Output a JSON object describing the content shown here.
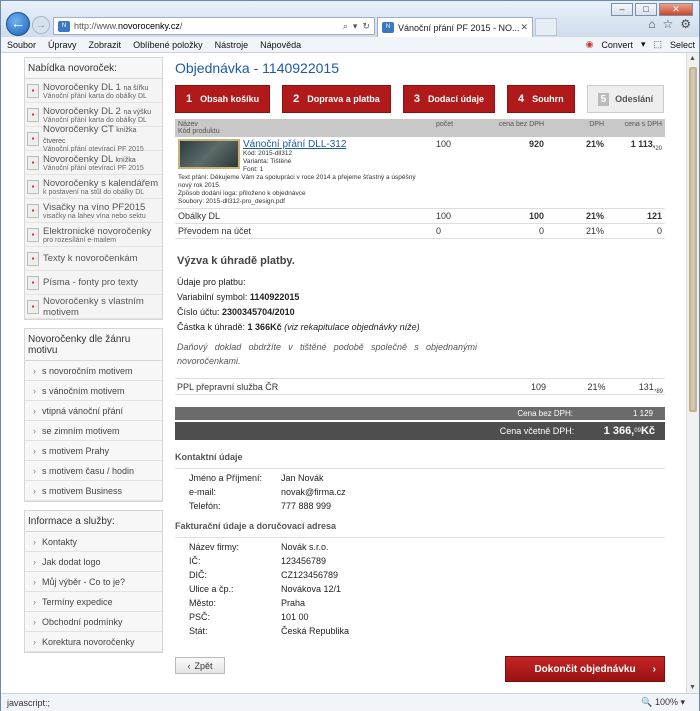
{
  "browser": {
    "url_prefix": "http://www.",
    "url_domain": "novorocenky.cz",
    "url_suffix": "/",
    "tab_title": "Vánoční přání PF 2015 - NO...",
    "min": "–",
    "max": "□",
    "close": "✕"
  },
  "menu": {
    "items": [
      "Soubor",
      "Úpravy",
      "Zobrazit",
      "Oblíbené položky",
      "Nástroje",
      "Nápověda"
    ],
    "convert": "Convert",
    "select": "Select"
  },
  "sidebar": {
    "offer_title": "Nabídka novoroček:",
    "products": [
      {
        "title": "Novoročenky DL 1",
        "suffix": "na šířku",
        "sub": "Vánoční přání karta do obálky DL"
      },
      {
        "title": "Novoročenky DL 2",
        "suffix": "na výšku",
        "sub": "Vánoční přání karta do obálky DL"
      },
      {
        "title": "Novoročenky CT",
        "suffix": "knížka čtverec",
        "sub": "Vánoční přání otevírací PF 2015"
      },
      {
        "title": "Novoročenky DL",
        "suffix": "knížka",
        "sub": "Vánoční přání otevírací PF 2015"
      },
      {
        "title": "Novoročenky s kalendářem",
        "suffix": "",
        "sub": "k postavení na stůl do obálky DL"
      },
      {
        "title": "Visačky na víno PF2015",
        "suffix": "",
        "sub": "visačky na lahev vína nebo sektu"
      },
      {
        "title": "Elektronické novoročenky",
        "suffix": "",
        "sub": "pro rozesílání e-mailem"
      },
      {
        "title": "Texty k novoročenkám",
        "suffix": "",
        "sub": ""
      },
      {
        "title": "Písma - fonty pro texty",
        "suffix": "",
        "sub": ""
      },
      {
        "title": "Novoročenky s vlastním motivem",
        "suffix": "",
        "sub": ""
      }
    ],
    "genre_title": "Novoročenky dle žánru motivu",
    "genres": [
      "s novoročním motivem",
      "s vánočním motivem",
      "vtipná vánoční přání",
      "se zimním motivem",
      "s motivem Prahy",
      "s motivem času / hodin",
      "s motivem Business"
    ],
    "info_title": "Informace a služby:",
    "info": [
      "Kontakty",
      "Jak dodat logo",
      "Můj výběr - Co to je?",
      "Termíny expedice",
      "Obchodní podmínky",
      "Korektura novoročenky"
    ]
  },
  "order": {
    "title": "Objednávka - 1140922015",
    "steps": [
      {
        "n": "1",
        "label": "Obsah košíku"
      },
      {
        "n": "2",
        "label": "Doprava a platba"
      },
      {
        "n": "3",
        "label": "Dodací údaje"
      },
      {
        "n": "4",
        "label": "Souhrn"
      },
      {
        "n": "5",
        "label": "Odeslání"
      }
    ],
    "headers": {
      "name": "Název",
      "code": "Kód produktu",
      "qty": "počet",
      "price": "cena bez DPH",
      "vat": "DPH",
      "total": "cena s DPH"
    },
    "item": {
      "name": "Vánoční přání DLL-312",
      "code": "Kód: 2015-dll312",
      "variant": "Varianta: Tištěné",
      "font": "Font: 1",
      "text": "Text přání: Děkujeme Vám za spolupráci v roce 2014 a přejeme šťastný a úspěšný nový rok 2015.",
      "logo": "Způsob dodání loga: přiloženo k objednávce",
      "files": "Soubory: 2015-dll312-pro_design.pdf",
      "qty": "100",
      "price": "920",
      "vat": "21%",
      "total": "1 113,",
      "total_cents": "20"
    },
    "rows": [
      {
        "name": "Obálky DL",
        "qty": "100",
        "price": "100",
        "vat": "21%",
        "total": "121"
      },
      {
        "name": "Převodem na účet",
        "qty": "0",
        "price": "0",
        "vat": "21%",
        "total": "0"
      }
    ],
    "payment_title": "Výzva k úhradě platby.",
    "pay_intro": "Údaje pro platbu:",
    "vs_label": "Variabilní symbol: ",
    "vs": "1140922015",
    "acct_label": "Číslo účtu: ",
    "acct": "2300345704/2010",
    "amt_label": "Částka k úhradě: ",
    "amt": "1 366Kč",
    "amt_note": " (viz rekapitulace objednávky níže)",
    "tax_note": "Daňový doklad obdržíte v tištěné podobě společně s objednanými novoročenkami.",
    "ppl": {
      "name": "PPL přepravní služba ČR",
      "price": "109",
      "vat": "21%",
      "total": "131,",
      "cents": "89"
    },
    "tot_no_vat_label": "Cena bez DPH:",
    "tot_no_vat": "1 129",
    "tot_vat_label": "Cena včetně DPH:",
    "tot_vat": "1 366,",
    "tot_vat_cents": "09",
    "tot_vat_cur": " Kč",
    "contact_title": "Kontaktní údaje",
    "contact": [
      {
        "k": "Jméno a Příjmení:",
        "v": "Jan Novák"
      },
      {
        "k": "e-mail:",
        "v": "novak@firma.cz"
      },
      {
        "k": "Telefón:",
        "v": "777 888 999"
      }
    ],
    "billing_title": "Fakturační údaje a doručovací adresa",
    "billing": [
      {
        "k": "Název firmy:",
        "v": "Novák s.r.o."
      },
      {
        "k": "IČ:",
        "v": "123456789"
      },
      {
        "k": "DIČ:",
        "v": "CZ123456789"
      },
      {
        "k": "Ulice a čp.:",
        "v": "Novákova 12/1"
      },
      {
        "k": "Město:",
        "v": "Praha"
      },
      {
        "k": "PSČ:",
        "v": "101 00"
      },
      {
        "k": "Stát:",
        "v": "Česká Republika"
      }
    ],
    "back": "Zpět",
    "finish": "Dokončit objednávku"
  },
  "status": {
    "text": "javascript:;",
    "zoom": "100%"
  }
}
